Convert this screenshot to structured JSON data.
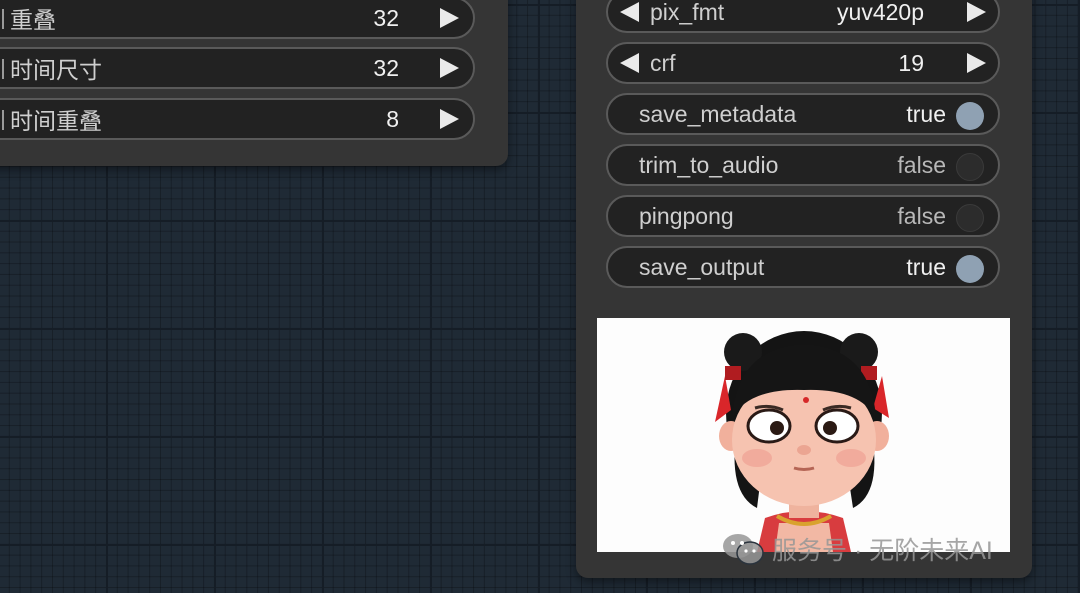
{
  "left_node": {
    "widgets": [
      {
        "label": "重叠",
        "value": "32"
      },
      {
        "label": "时间尺寸",
        "value": "32"
      },
      {
        "label": "时间重叠",
        "value": "8"
      }
    ]
  },
  "right_node": {
    "combos": [
      {
        "label": "pix_fmt",
        "value": "yuv420p"
      },
      {
        "label": "crf",
        "value": "19"
      }
    ],
    "toggles": [
      {
        "label": "save_metadata",
        "value": "true",
        "on": true
      },
      {
        "label": "trim_to_audio",
        "value": "false",
        "on": false
      },
      {
        "label": "pingpong",
        "value": "false",
        "on": false
      },
      {
        "label": "save_output",
        "value": "true",
        "on": true
      }
    ],
    "preview_icon": "cartoon-girl-image"
  },
  "watermark": {
    "icon": "wechat-icon",
    "text": "服务号 · 无阶未来AI"
  },
  "colors": {
    "canvas_bg": "#1f2a35",
    "node_bg": "#353535",
    "widget_bg": "#222222",
    "toggle_on": "#8fa1b3"
  }
}
